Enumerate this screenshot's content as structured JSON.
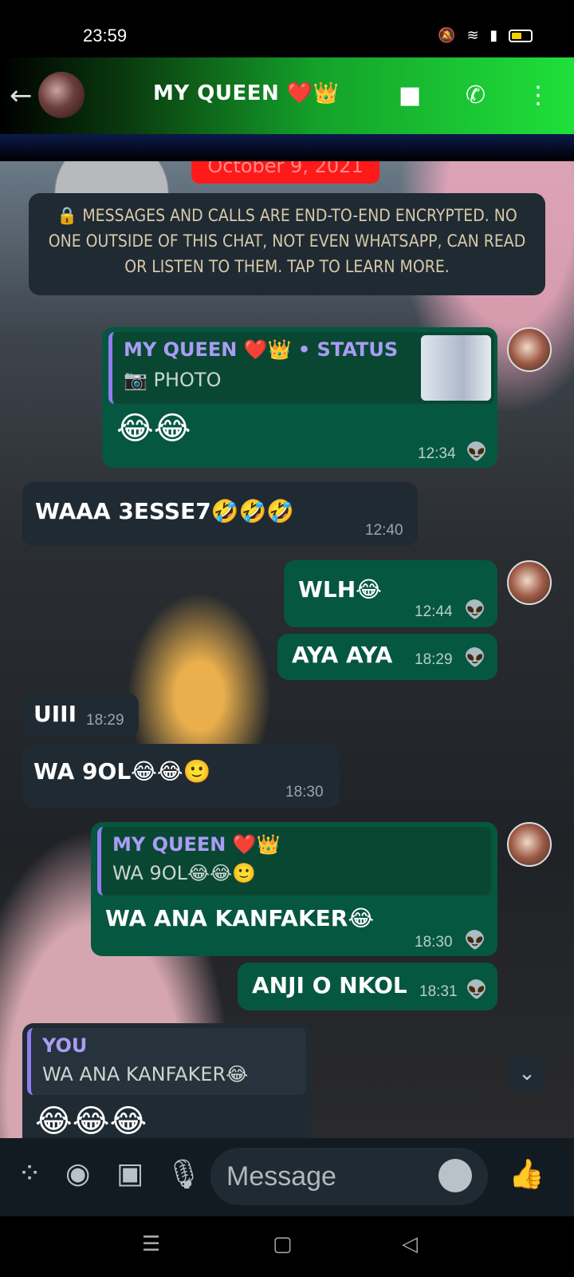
{
  "status_bar": {
    "time": "23:59",
    "icons": [
      "mute-icon",
      "wifi-icon",
      "signal-icon",
      "battery-icon"
    ]
  },
  "header": {
    "title": "MY QUEEN ❤️👑",
    "back_icon": "back-arrow-icon",
    "video_icon": "video-call-icon",
    "call_icon": "voice-call-icon",
    "menu_icon": "more-icon"
  },
  "chat": {
    "date_chip": "October 9, 2021",
    "system_message": "🔒 MESSAGES AND CALLS ARE END-TO-END ENCRYPTED. NO ONE OUTSIDE OF THIS CHAT, NOT EVEN WHATSAPP, CAN READ OR LISTEN TO THEM. TAP TO LEARN MORE.",
    "messages": [
      {
        "dir": "out",
        "quote_name": "MY QUEEN ❤️👑 • STATUS",
        "quote_body": "📷 PHOTO",
        "text": "😂😂",
        "time": "12:34"
      },
      {
        "dir": "in",
        "text": "WAAA 3ESSE7🤣🤣🤣",
        "time": "12:40"
      },
      {
        "dir": "out",
        "text": "WLH😂",
        "time": "12:44"
      },
      {
        "dir": "out",
        "text": "AYA AYA",
        "time": "18:29"
      },
      {
        "dir": "in",
        "text": "UIII",
        "time": "18:29"
      },
      {
        "dir": "in",
        "text": "WA 9OL😂😂🙂",
        "time": "18:30"
      },
      {
        "dir": "out",
        "quote_name": "MY QUEEN ❤️👑",
        "quote_body": "WA 9OL😂😂🙂",
        "text": "WA ANA KANFAKER😂",
        "time": "18:30"
      },
      {
        "dir": "out",
        "text": "ANJI O NKOL",
        "time": "18:31"
      },
      {
        "dir": "in",
        "quote_name": "YOU",
        "quote_body": "WA ANA KANFAKER😂",
        "text": "😂😂😂",
        "time": ""
      }
    ],
    "read_tick": "👽"
  },
  "composer": {
    "placeholder": "Message",
    "icons": [
      "attach-icon",
      "camera-icon",
      "gallery-icon",
      "mic-icon",
      "emoji-icon",
      "thumbs-up-icon"
    ]
  },
  "nav": {
    "recents": "☰",
    "home": "▢",
    "back": "◁"
  }
}
